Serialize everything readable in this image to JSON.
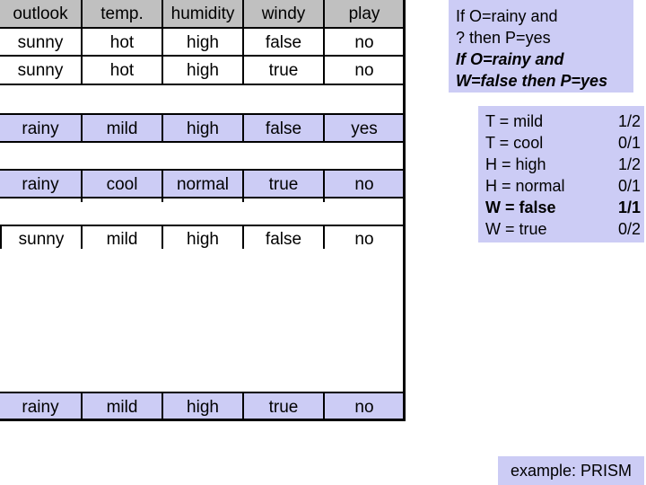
{
  "table": {
    "headers": [
      "outlook",
      "temp.",
      "humidity",
      "windy",
      "play"
    ],
    "rows": [
      [
        "sunny",
        "hot",
        "high",
        "false",
        "no"
      ],
      [
        "sunny",
        "hot",
        "high",
        "true",
        "no"
      ],
      [
        "rainy",
        "mild",
        "high",
        "false",
        "yes"
      ],
      [
        "rainy",
        "cool",
        "normal",
        "true",
        "no"
      ],
      [
        "sunny",
        "mild",
        "high",
        "false",
        "no"
      ],
      [
        "rainy",
        "mild",
        "high",
        "true",
        "no"
      ]
    ],
    "highlight_color": "#ccccf5",
    "header_color": "#c0c0c0"
  },
  "rule_box": {
    "line1": "If O=rainy and",
    "line2": "? then P=yes",
    "line3": "If O=rainy and",
    "line4": "W=false then P=yes"
  },
  "candidates": [
    {
      "test": "T = mild",
      "ratio": "1/2",
      "selected": false
    },
    {
      "test": "T = cool",
      "ratio": "0/1",
      "selected": false
    },
    {
      "test": "H = high",
      "ratio": "1/2",
      "selected": false
    },
    {
      "test": "H = normal",
      "ratio": "0/1",
      "selected": false
    },
    {
      "test": "W = false",
      "ratio": "1/1",
      "selected": true
    },
    {
      "test": "W = true",
      "ratio": "0/2",
      "selected": false
    }
  ],
  "caption": "example: PRISM"
}
